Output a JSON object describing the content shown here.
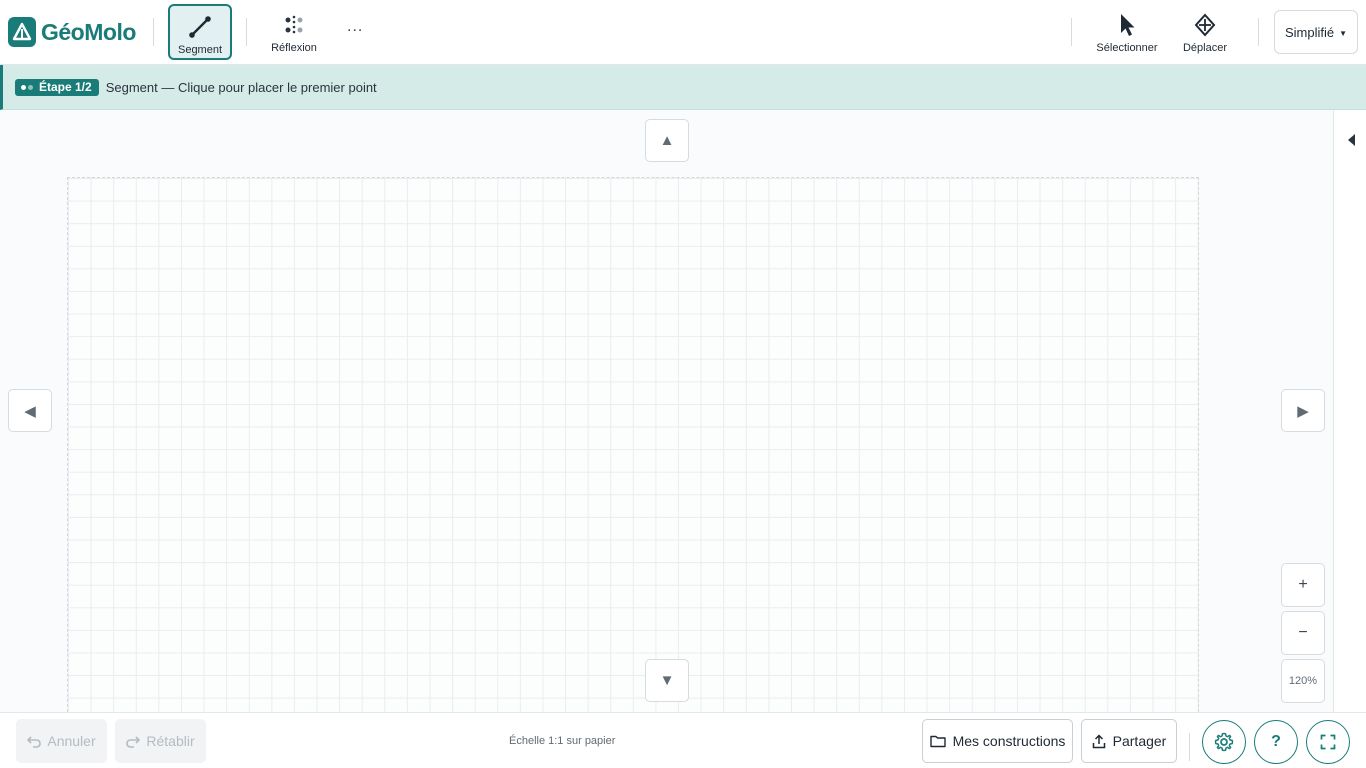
{
  "app": {
    "logo_text": "GéoMolo",
    "brand_color": "#1a7c79"
  },
  "toolbar": {
    "tools": [
      {
        "label": "Segment",
        "icon": "segment-icon",
        "active": true
      },
      {
        "label": "Réflexion",
        "icon": "reflection-icon",
        "active": false
      }
    ],
    "more_label": "...",
    "right_tools": [
      {
        "label": "Sélectionner",
        "icon": "cursor-icon"
      },
      {
        "label": "Déplacer",
        "icon": "move-icon"
      }
    ],
    "mode": {
      "value": "Simplifié"
    }
  },
  "banner": {
    "step": "Étape 1/2",
    "text": "Segment — Clique pour placer le premier point",
    "steps_done": 1,
    "steps_total": 2
  },
  "canvas": {
    "pan_up": "▲",
    "pan_down": "▼",
    "pan_left": "◀",
    "pan_right": "▶",
    "zoom_in": "+",
    "zoom_out": "−",
    "zoom_level": "120%",
    "side_toggle": "◀"
  },
  "bottom": {
    "undo": "Annuler",
    "redo": "Rétablir",
    "scale": "Échelle 1:1 sur papier",
    "my_constructions": "Mes constructions",
    "share": "Partager",
    "help": "?"
  }
}
